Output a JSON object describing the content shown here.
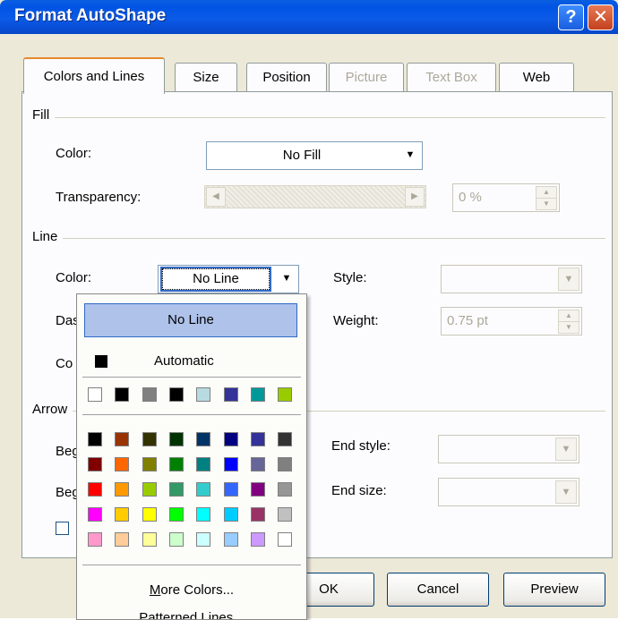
{
  "window": {
    "title": "Format AutoShape",
    "help_label": "?",
    "close_label": "✕"
  },
  "tabs": [
    "Colors and Lines",
    "Size",
    "Position",
    "Picture",
    "Text Box",
    "Web"
  ],
  "fill": {
    "section": "Fill",
    "color_label": "Color:",
    "color_value": "No Fill",
    "transparency_label": "Transparency:",
    "transparency_value": "0 %"
  },
  "line": {
    "section": "Line",
    "color_label": "Color:",
    "color_value": "No Line",
    "dashed_label_partial": "Das",
    "connector_label_partial": "Co",
    "style_label": "Style:",
    "weight_label": "Weight:",
    "weight_value": "0.75 pt"
  },
  "arrows": {
    "section_partial": "Arrow",
    "begin_style_partial": "Beg",
    "begin_size_partial": "Beg",
    "end_style_label": "End style:",
    "end_size_label": "End size:"
  },
  "buttons": {
    "ok": "OK",
    "cancel": "Cancel",
    "preview": "Preview"
  },
  "color_popup": {
    "no_line": "No Line",
    "automatic": "Automatic",
    "automatic_color": "#000000",
    "recent_colors": [
      "#ffffff",
      "#000000",
      "#808080",
      "#000000",
      "#b7dbe0",
      "#333399",
      "#009999",
      "#99cc00"
    ],
    "palette": [
      [
        "#000000",
        "#993300",
        "#333300",
        "#003300",
        "#003366",
        "#000080",
        "#333399",
        "#333333"
      ],
      [
        "#800000",
        "#ff6600",
        "#808000",
        "#008000",
        "#008080",
        "#0000ff",
        "#666699",
        "#808080"
      ],
      [
        "#ff0000",
        "#ff9900",
        "#99cc00",
        "#339966",
        "#33cccc",
        "#3366ff",
        "#800080",
        "#969696"
      ],
      [
        "#ff00ff",
        "#ffcc00",
        "#ffff00",
        "#00ff00",
        "#00ffff",
        "#00ccff",
        "#993366",
        "#c0c0c0"
      ],
      [
        "#ff99cc",
        "#ffcc99",
        "#ffff99",
        "#ccffcc",
        "#ccffff",
        "#99ccff",
        "#cc99ff",
        "#ffffff"
      ]
    ],
    "more_colors": "More Colors...",
    "patterned_lines": "Patterned Lines..."
  }
}
